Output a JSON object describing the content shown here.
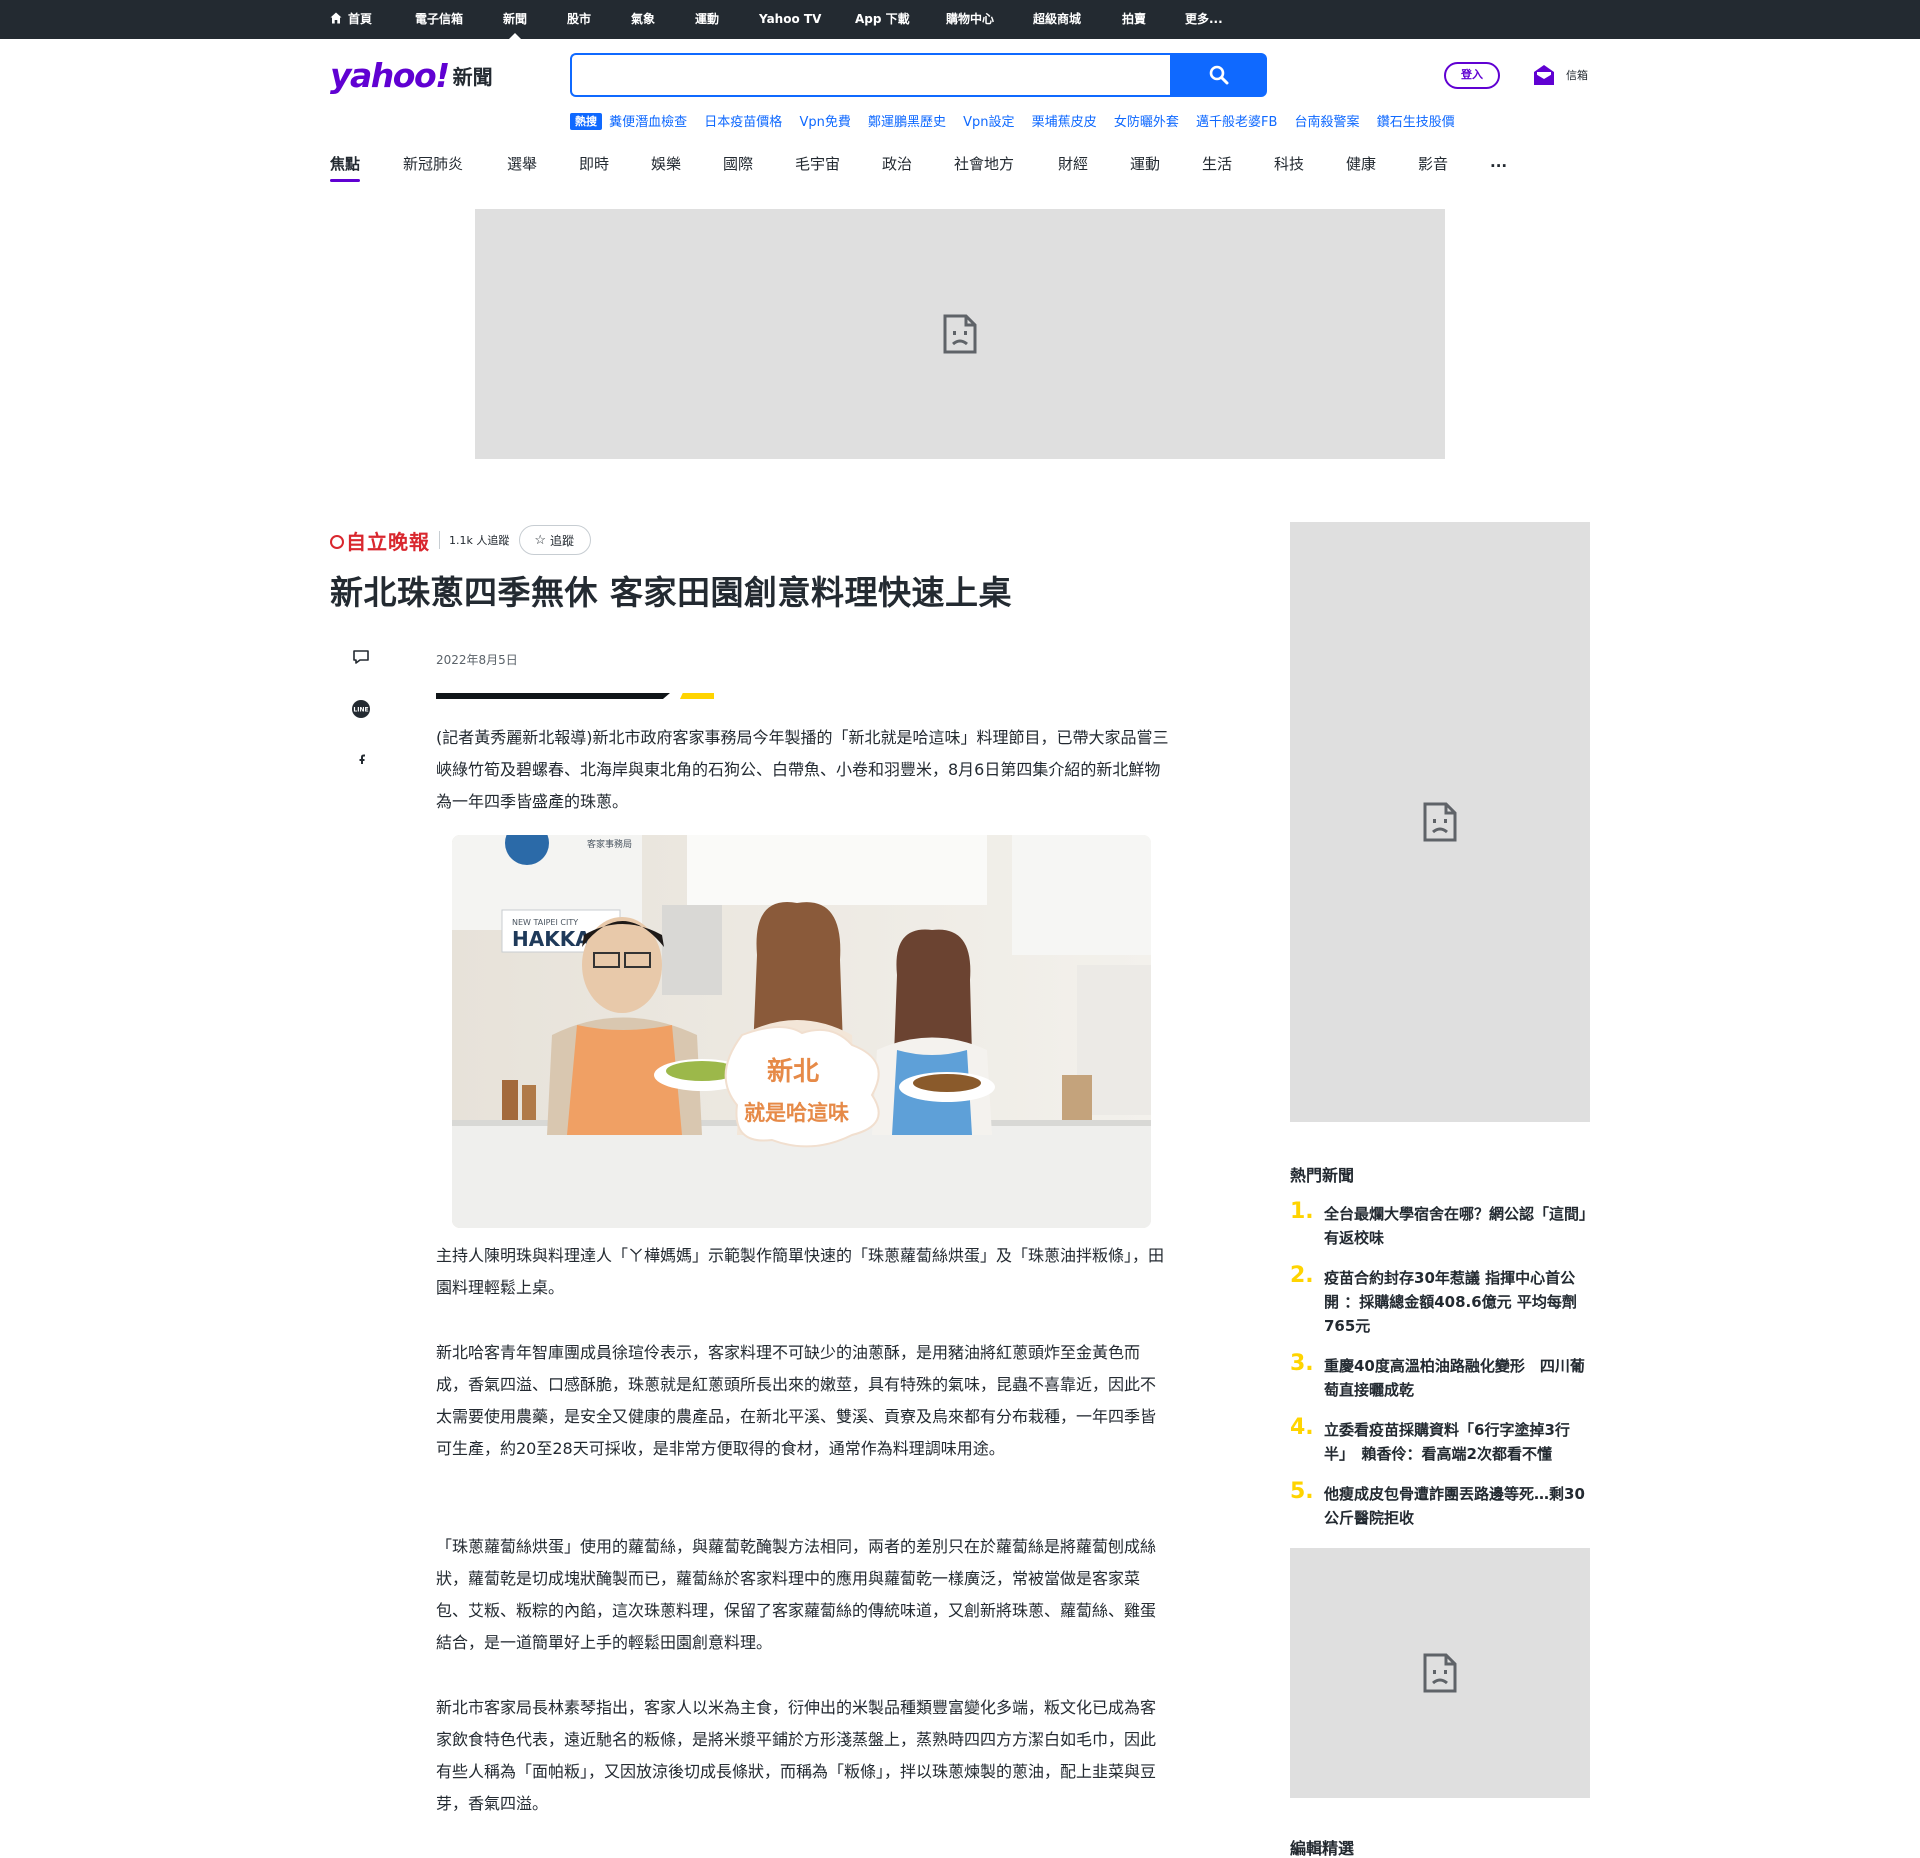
{
  "topnav": {
    "items": [
      {
        "label": "首頁"
      },
      {
        "label": "電子信箱"
      },
      {
        "label": "新聞"
      },
      {
        "label": "股市"
      },
      {
        "label": "氣象"
      },
      {
        "label": "運動"
      },
      {
        "label": "Yahoo TV"
      },
      {
        "label": "App 下載"
      },
      {
        "label": "購物中心"
      },
      {
        "label": "超級商城"
      },
      {
        "label": "拍賣"
      },
      {
        "label": "更多..."
      }
    ],
    "active_index": 2
  },
  "header": {
    "logo_word": "yahoo!",
    "logo_sub": "新聞",
    "search_value": "",
    "login_label": "登入",
    "mail_label": "信箱"
  },
  "trending": {
    "badge": "熱搜",
    "links": [
      "糞便潛血檢查",
      "日本疫苗價格",
      "Vpn免費",
      "鄭運鵬黑歷史",
      "Vpn設定",
      "栗埔蕉皮皮",
      "女防曬外套",
      "邁千般老婆FB",
      "台南殺警案",
      "鑽石生技股價"
    ]
  },
  "categories": {
    "items": [
      "焦點",
      "新冠肺炎",
      "選舉",
      "即時",
      "娛樂",
      "國際",
      "毛宇宙",
      "政治",
      "社會地方",
      "財經",
      "運動",
      "生活",
      "科技",
      "健康",
      "影音",
      "..."
    ],
    "active_index": 0
  },
  "article": {
    "publisher": "自立晚報",
    "followers": "1.1k 人追蹤",
    "follow_label": "追蹤",
    "title": "新北珠蔥四季無休 客家田園創意料理快速上桌",
    "date": "2022年8月5日",
    "paragraphs": [
      "(記者黃秀麗新北報導)新北市政府客家事務局今年製播的「新北就是哈這味」料理節目，已帶大家品嘗三峽綠竹筍及碧螺春、北海岸與東北角的石狗公、白帶魚、小卷和羽豐米，8月6日第四集介紹的新北鮮物為一年四季皆盛產的珠蔥。",
      "主持人陳明珠與料理達人「ㄚ樺媽媽」示範製作簡單快速的「珠蔥蘿蔔絲烘蛋」及「珠蔥油拌粄條」，田園料理輕鬆上桌。",
      "新北哈客青年智庫團成員徐瑄伶表示，客家料理不可缺少的油蔥酥，是用豬油將紅蔥頭炸至金黃色而成，香氣四溢、口感酥脆，珠蔥就是紅蔥頭所長出來的嫩莖，具有特殊的氣味，昆蟲不喜靠近，因此不太需要使用農藥，是安全又健康的農產品，在新北平溪、雙溪、貢寮及烏來都有分布栽種，一年四季皆可生產，約20至28天可採收，是非常方便取得的食材，通常作為料理調味用途。",
      "「珠蔥蘿蔔絲烘蛋」使用的蘿蔔絲，與蘿蔔乾醃製方法相同，兩者的差別只在於蘿蔔絲是將蘿蔔刨成絲狀，蘿蔔乾是切成塊狀醃製而已，蘿蔔絲於客家料理中的應用與蘿蔔乾一樣廣泛，常被當做是客家菜包、艾粄、粄粽的內餡，這次珠蔥料理，保留了客家蘿蔔絲的傳統味道，又創新將珠蔥、蘿蔔絲、雞蛋結合，是一道簡單好上手的輕鬆田園創意料理。",
      "新北市客家局長林素琴指出，客家人以米為主食，衍伸出的米製品種類豐富變化多端，粄文化已成為客家飲食特色代表，遠近馳名的粄條，是將米漿平鋪於方形淺蒸盤上，蒸熟時四四方方潔白如毛巾，因此有些人稱為「面帕粄」，又因放涼後切成長條狀，而稱為「粄條」，拌以珠蔥煉製的蔥油，配上韭菜與豆芽，香氣四溢。"
    ],
    "photo": {
      "wall_sign_top": "客家事務局",
      "wall_sign_en": "NEW TAIPEI CITY",
      "wall_sign": "HAKKA",
      "prop_line1": "新北",
      "prop_line2": "就是哈這味"
    }
  },
  "sidebar": {
    "hot_title": "熱門新聞",
    "hot_items": [
      {
        "num": "1.",
        "text": "全台最爛大學宿舍在哪？網公認「這間」有返校味"
      },
      {
        "num": "2.",
        "text": "疫苗合約封存30年惹議 指揮中心首公開 ：採購總金額408.6億元 平均每劑765元"
      },
      {
        "num": "3.",
        "text": "重慶40度高溫柏油路融化變形　四川葡萄直接曬成乾"
      },
      {
        "num": "4.",
        "text": "立委看疫苗採購資料「6行字塗掉3行半」　賴香伶：看高端2次都看不懂"
      },
      {
        "num": "5.",
        "text": "他瘦成皮包骨遭詐團丟路邊等死…剩30公斤醫院拒收"
      }
    ],
    "editor_title": "編輯精選"
  },
  "colors": {
    "brand": "#6001d2",
    "link": "#0f69ff",
    "accent": "#ffd400",
    "topbar": "#232a31"
  }
}
